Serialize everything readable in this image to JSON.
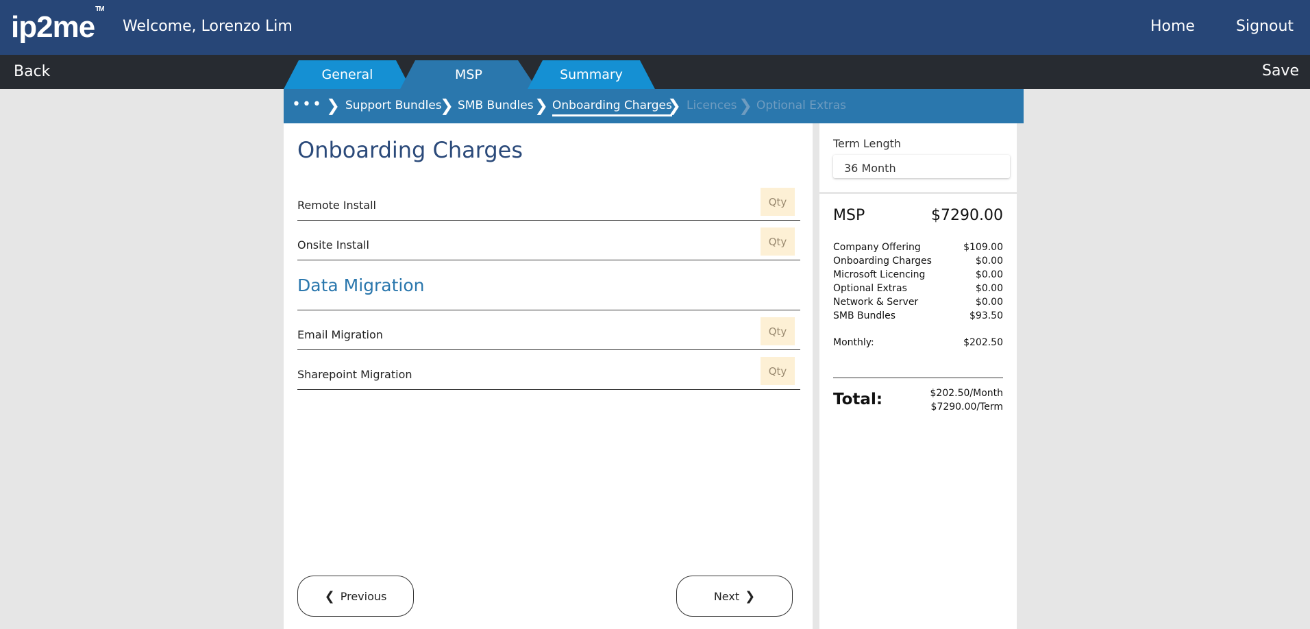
{
  "header": {
    "logo": "ip2me",
    "logo_tm": "TM",
    "welcome": "Welcome, Lorenzo Lim",
    "nav": {
      "home": "Home",
      "signout": "Signout"
    }
  },
  "subbar": {
    "back": "Back",
    "save": "Save"
  },
  "tabs": [
    {
      "label": "General"
    },
    {
      "label": "MSP"
    },
    {
      "label": "Summary"
    }
  ],
  "breadcrumb": {
    "more": "•••",
    "items": [
      {
        "label": "Support Bundles"
      },
      {
        "label": "SMB Bundles"
      },
      {
        "label": "Onboarding Charges"
      },
      {
        "label": "Licences"
      },
      {
        "label": "Optional Extras"
      }
    ]
  },
  "main": {
    "title": "Onboarding Charges",
    "rows": [
      {
        "label": "Remote Install",
        "placeholder": "Qty"
      },
      {
        "label": "Onsite Install",
        "placeholder": "Qty"
      }
    ],
    "section_title": "Data Migration",
    "section_rows": [
      {
        "label": "Email Migration",
        "placeholder": "Qty"
      },
      {
        "label": "Sharepoint Migration",
        "placeholder": "Qty"
      }
    ],
    "previous": "Previous",
    "next": "Next"
  },
  "sidebar": {
    "term_label": "Term Length",
    "term_value": "36 Month",
    "msp_label": "MSP",
    "msp_total": "$7290.00",
    "line_items": [
      {
        "label": "Company Offering",
        "value": "$109.00"
      },
      {
        "label": "Onboarding Charges",
        "value": "$0.00"
      },
      {
        "label": "Microsoft Licencing",
        "value": "$0.00"
      },
      {
        "label": "Optional Extras",
        "value": "$0.00"
      },
      {
        "label": "Network & Server",
        "value": "$0.00"
      },
      {
        "label": "SMB Bundles",
        "value": "$93.50"
      }
    ],
    "monthly_label": "Monthly:",
    "monthly_value": "$202.50",
    "total_label": "Total:",
    "total_month": "$202.50/Month",
    "total_term": "$7290.00/Term"
  }
}
